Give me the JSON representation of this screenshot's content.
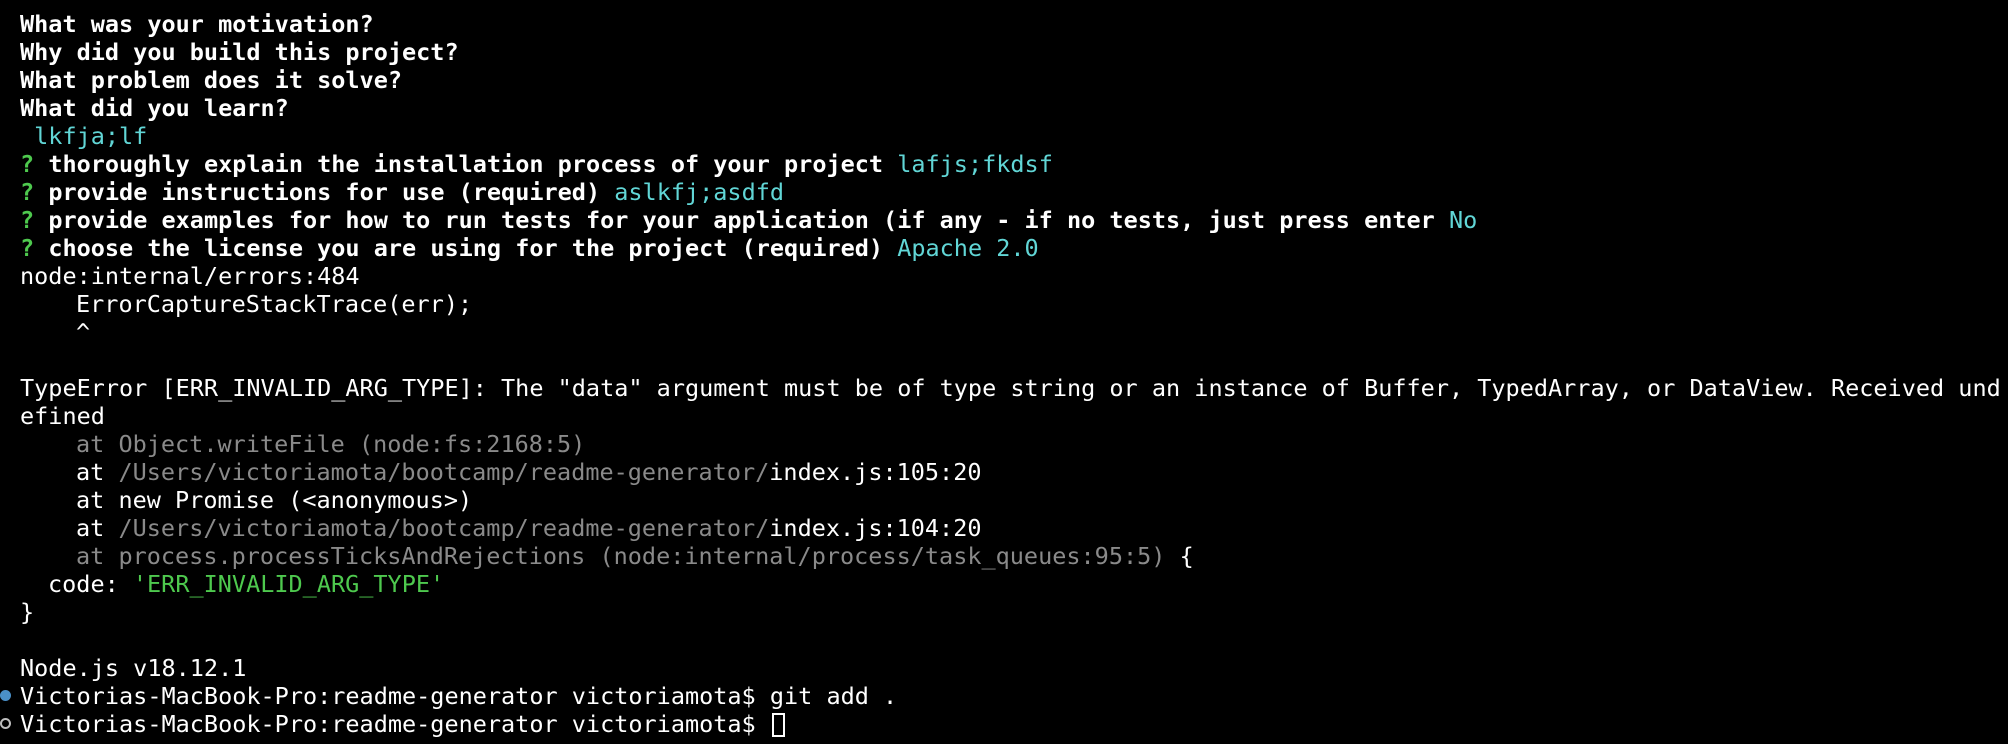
{
  "questions": [
    "What was your motivation?",
    "Why did you build this project?",
    "What problem does it solve?",
    "What did you learn?"
  ],
  "description_answer": " lkfja;lf",
  "prompts": [
    {
      "mark": "?",
      "question": "thoroughly explain the installation process of your project",
      "answer": "lafjs;fkdsf"
    },
    {
      "mark": "?",
      "question": "provide instructions for use (required)",
      "answer": "aslkfj;asdfd"
    },
    {
      "mark": "?",
      "question": "provide examples for how to run tests for your application (if any - if no tests, just press enter",
      "answer": "No"
    },
    {
      "mark": "?",
      "question": "choose the license you are using for the project (required)",
      "answer": "Apache 2.0"
    }
  ],
  "error": {
    "location": "node:internal/errors:484",
    "source_line": "ErrorCaptureStackTrace(err);",
    "caret": "^",
    "message_line1": "TypeError [ERR_INVALID_ARG_TYPE]: The \"data\" argument must be of type string or an instance of Buffer, TypedArray, or DataView. Received und",
    "message_line2": "efined",
    "stack": [
      {
        "prefix": "at Object.writeFile (node:fs:2168:5)",
        "path": "",
        "file": "",
        "suffix": ""
      },
      {
        "prefix": "at ",
        "path": "/Users/victoriamota/bootcamp/readme-generator/",
        "file": "index.js:105:20",
        "suffix": ""
      },
      {
        "prefix": "at new Promise (<anonymous>)",
        "path": "",
        "file": "",
        "suffix": ""
      },
      {
        "prefix": "at ",
        "path": "/Users/victoriamota/bootcamp/readme-generator/",
        "file": "index.js:104:20",
        "suffix": ""
      },
      {
        "prefix": "at process.processTicksAndRejections (node:internal/process/task_queues:95:5)",
        "path": "",
        "file": "",
        "suffix": " {"
      }
    ],
    "code_key": "code: ",
    "code_value": "'ERR_INVALID_ARG_TYPE'",
    "close_brace": "}"
  },
  "node_version": "Node.js v18.12.1",
  "shell": [
    {
      "prompt": "Victorias-MacBook-Pro:readme-generator victoriamota$ ",
      "command": "git add ."
    },
    {
      "prompt": "Victorias-MacBook-Pro:readme-generator victoriamota$ ",
      "command": ""
    }
  ],
  "colors": {
    "background": "#000000",
    "foreground": "#ffffff",
    "answer": "#61d6d6",
    "prompt_mark": "#4ec94e",
    "dim": "#8a8a8a",
    "mark_filled": "#4a90c8"
  }
}
